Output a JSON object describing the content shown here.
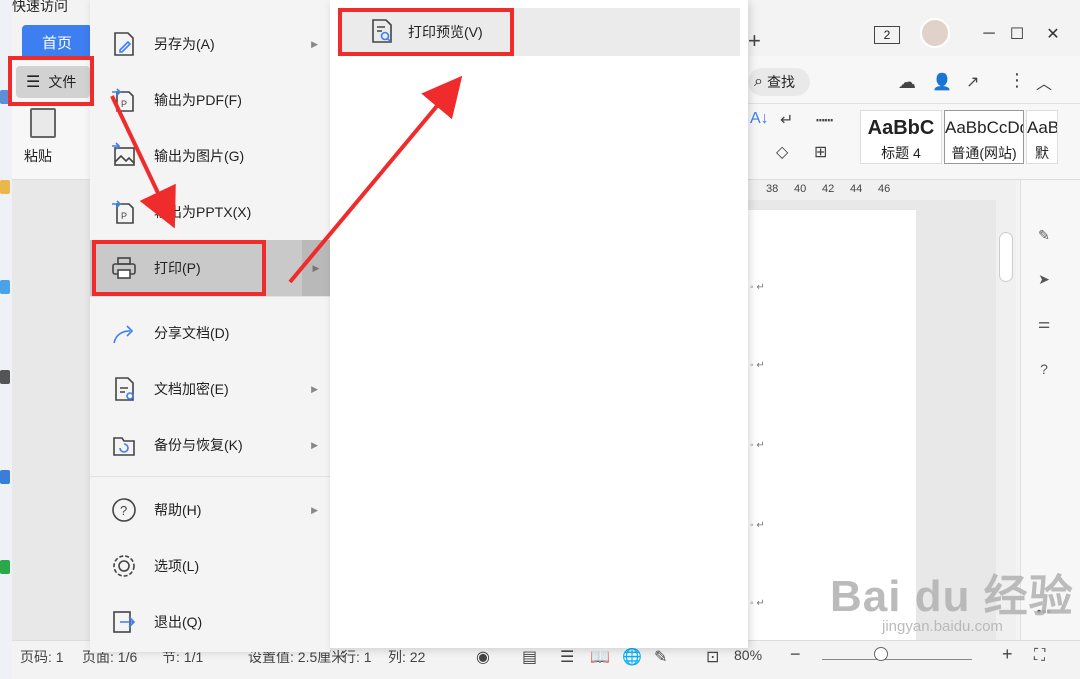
{
  "app": {
    "quick_access_label": "快速访问",
    "home_tab": "首页",
    "tab_count": "2",
    "file_button": "文件",
    "search_label": "查找",
    "paste_label": "粘贴",
    "styles": [
      {
        "sample": "AaBbC",
        "name": "标题 4"
      },
      {
        "sample": "AaBbCcDd",
        "name": "普通(网站)"
      },
      {
        "sample": "AaBl",
        "name": "默"
      }
    ]
  },
  "ruler": {
    "ticks": [
      "38",
      "40",
      "42",
      "44",
      "46"
    ]
  },
  "file_menu": {
    "items": [
      {
        "label": "另存为(A)",
        "icon": "save-as-icon",
        "arrow": true
      },
      {
        "label": "输出为PDF(F)",
        "icon": "export-pdf-icon",
        "arrow": false
      },
      {
        "label": "输出为图片(G)",
        "icon": "export-image-icon",
        "arrow": false
      },
      {
        "label": "输出为PPTX(X)",
        "icon": "export-pptx-icon",
        "arrow": false
      },
      {
        "label": "打印(P)",
        "icon": "print-icon",
        "arrow": true
      },
      {
        "label": "分享文档(D)",
        "icon": "share-icon",
        "arrow": false
      },
      {
        "label": "文档加密(E)",
        "icon": "encrypt-icon",
        "arrow": true
      },
      {
        "label": "备份与恢复(K)",
        "icon": "backup-icon",
        "arrow": true
      },
      {
        "label": "帮助(H)",
        "icon": "help-icon",
        "arrow": true
      },
      {
        "label": "选项(L)",
        "icon": "options-icon",
        "arrow": false
      },
      {
        "label": "退出(Q)",
        "icon": "exit-icon",
        "arrow": false
      }
    ]
  },
  "submenu": {
    "items": [
      {
        "label": "打印预览(V)",
        "icon": "print-preview-icon"
      }
    ]
  },
  "statusbar": {
    "page": "页码: 1",
    "pages": "页面: 1/6",
    "section": "节: 1/1",
    "setting": "设置值: 2.5厘米",
    "row": "行: 1",
    "col": "列: 22",
    "zoom": "80%"
  },
  "watermark": {
    "main": "Bai du 经验",
    "sub": "jingyan.baidu.com"
  },
  "colors": {
    "highlight": "#f02b2b",
    "accent": "#3d7ef0"
  }
}
